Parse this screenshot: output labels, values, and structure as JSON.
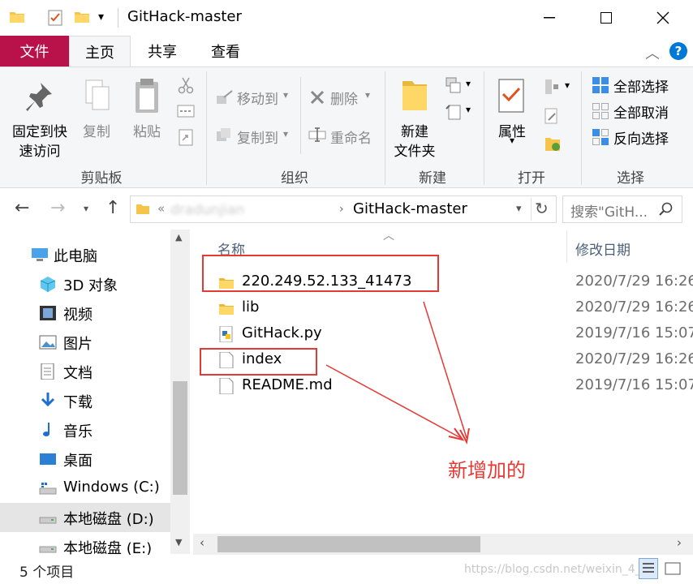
{
  "window": {
    "title": "GitHack-master"
  },
  "tabs": {
    "file": "文件",
    "home": "主页",
    "share": "共享",
    "view": "查看"
  },
  "ribbon": {
    "pin": "固定到快\n速访问",
    "pin_l1": "固定到快",
    "pin_l2": "速访问",
    "copy": "复制",
    "paste": "粘贴",
    "group_clipboard": "剪贴板",
    "move_to": "移动到",
    "copy_to": "复制到",
    "delete": "删除",
    "rename": "重命名",
    "group_organize": "组织",
    "new_folder_l1": "新建",
    "new_folder_l2": "文件夹",
    "group_new": "新建",
    "properties": "属性",
    "group_open": "打开",
    "select_all": "全部选择",
    "select_none": "全部取消",
    "invert": "反向选择",
    "group_select": "选择"
  },
  "address": {
    "prefix": "«",
    "blurred": "            dradunjian",
    "path": "GitHack-master",
    "search_placeholder": "搜索\"GitH..."
  },
  "nav": {
    "items": [
      "此电脑",
      "3D 对象",
      "视频",
      "图片",
      "文档",
      "下载",
      "音乐",
      "桌面",
      "Windows (C:)",
      "本地磁盘 (D:)",
      "本地磁盘 (E:)"
    ]
  },
  "columns": {
    "name": "名称",
    "date": "修改日期"
  },
  "files": [
    {
      "name": "220.249.52.133_41473",
      "date": "2020/7/29 16:26",
      "icon": "folder-icon"
    },
    {
      "name": "lib",
      "date": "2020/7/29 16:26",
      "icon": "folder-icon"
    },
    {
      "name": "GitHack.py",
      "date": "2019/7/16 15:07",
      "icon": "python-file-icon"
    },
    {
      "name": "index",
      "date": "2020/7/29 16:26",
      "icon": "file-icon"
    },
    {
      "name": "README.md",
      "date": "2019/7/16 15:07",
      "icon": "file-icon"
    }
  ],
  "annotation": {
    "text": "新增加的",
    "color": "#e53935"
  },
  "status": {
    "count": "5 个项目",
    "watermark": "https://blog.csdn.net/weixin_4___"
  },
  "colors": {
    "file_tab": "#b9124a",
    "accent": "#0078d7",
    "folder": "#f4c54a"
  }
}
